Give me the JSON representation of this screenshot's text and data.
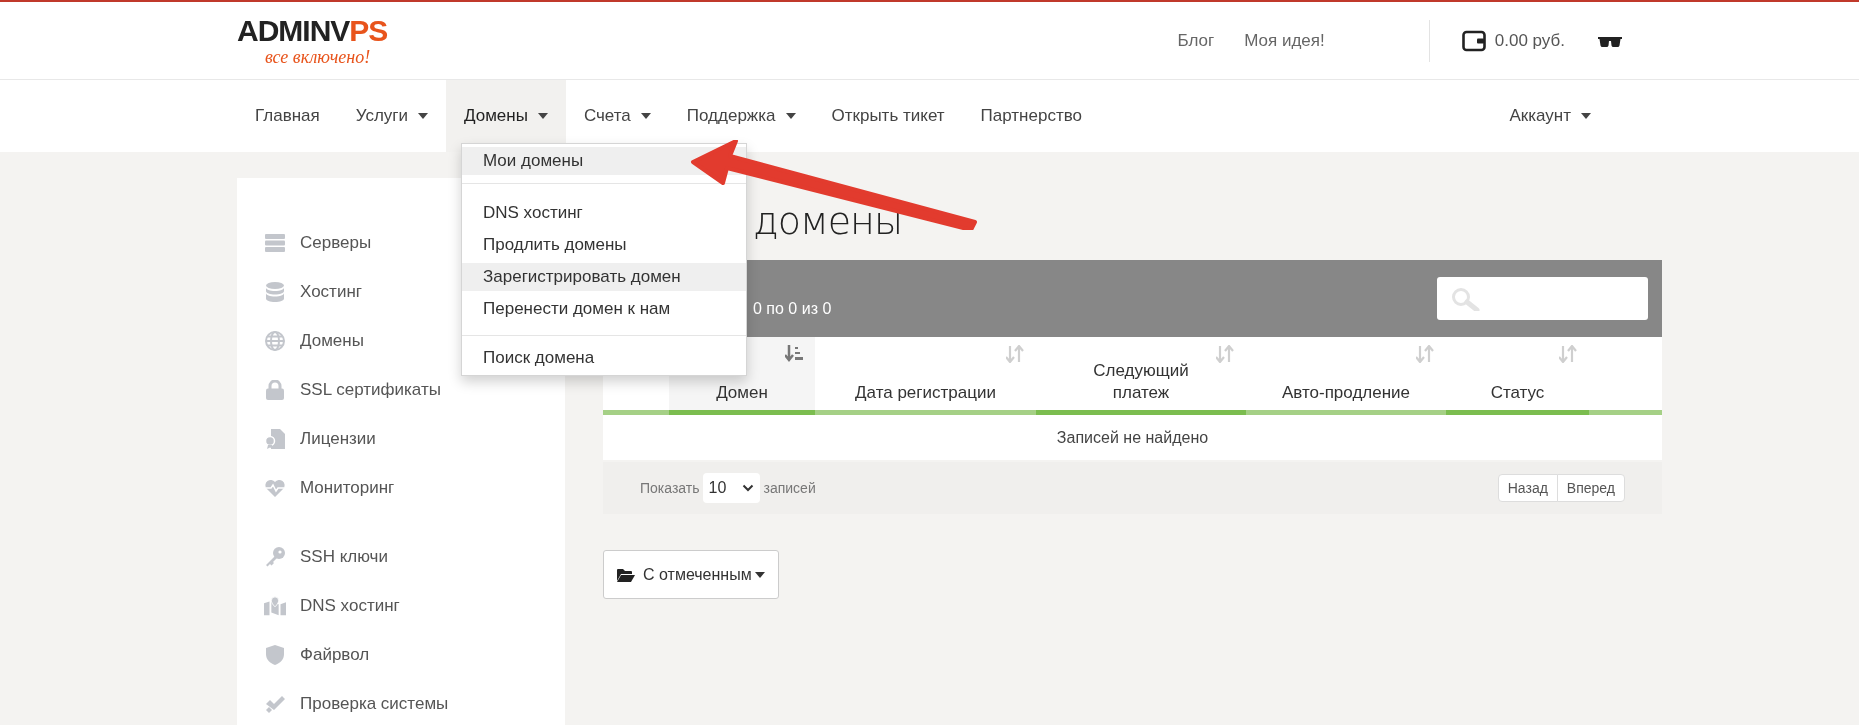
{
  "logo": {
    "parts": [
      {
        "text": "ADMINV",
        "accent": false
      },
      {
        "text": "PS",
        "accent": true
      }
    ],
    "tagline": "все включено!"
  },
  "top_links": [
    "Блог",
    "Моя идея!"
  ],
  "balance": "0.00 руб.",
  "nav": [
    {
      "label": "Главная",
      "dropdown": false,
      "selected": false
    },
    {
      "label": "Услуги",
      "dropdown": true,
      "selected": false
    },
    {
      "label": "Домены",
      "dropdown": true,
      "selected": true
    },
    {
      "label": "Счета",
      "dropdown": true,
      "selected": false
    },
    {
      "label": "Поддержка",
      "dropdown": true,
      "selected": false
    },
    {
      "label": "Открыть тикет",
      "dropdown": false,
      "selected": false
    },
    {
      "label": "Партнерство",
      "dropdown": false,
      "selected": false
    }
  ],
  "account": {
    "label": "Аккаунт"
  },
  "dropdown": {
    "groups": [
      [
        {
          "label": "Мои домены",
          "highlighted": true
        }
      ],
      [
        {
          "label": "DNS хостинг",
          "highlighted": false
        },
        {
          "label": "Продлить домены",
          "highlighted": false
        },
        {
          "label": "Зарегистрировать домен",
          "highlighted": true
        },
        {
          "label": "Перенести домен к нам",
          "highlighted": false
        }
      ],
      [
        {
          "label": "Поиск домена",
          "highlighted": false
        }
      ]
    ]
  },
  "sidebar": {
    "groups": [
      [
        "Серверы",
        "Хостинг",
        "Домены",
        "SSL сертификаты",
        "Лицензии",
        "Мониторинг"
      ],
      [
        "SSH ключи",
        "DNS хостинг",
        "Файрвол",
        "Проверка системы"
      ]
    ]
  },
  "page_title": "домены",
  "table": {
    "info": "0 по 0 из 0",
    "columns": [
      {
        "label": "Домен",
        "sorted": true
      },
      {
        "label": "Дата регистрации",
        "sorted": false
      },
      {
        "label": "Следующий платеж",
        "sorted": false
      },
      {
        "label": "Авто-продление",
        "sorted": false
      },
      {
        "label": "Статус",
        "sorted": false
      }
    ],
    "empty_message": "Записей не найдено",
    "show_label": "Показать",
    "page_size": "10",
    "records_label": "записей",
    "pager": [
      "Назад",
      "Вперед"
    ]
  },
  "bulk_button": "С отмеченным"
}
